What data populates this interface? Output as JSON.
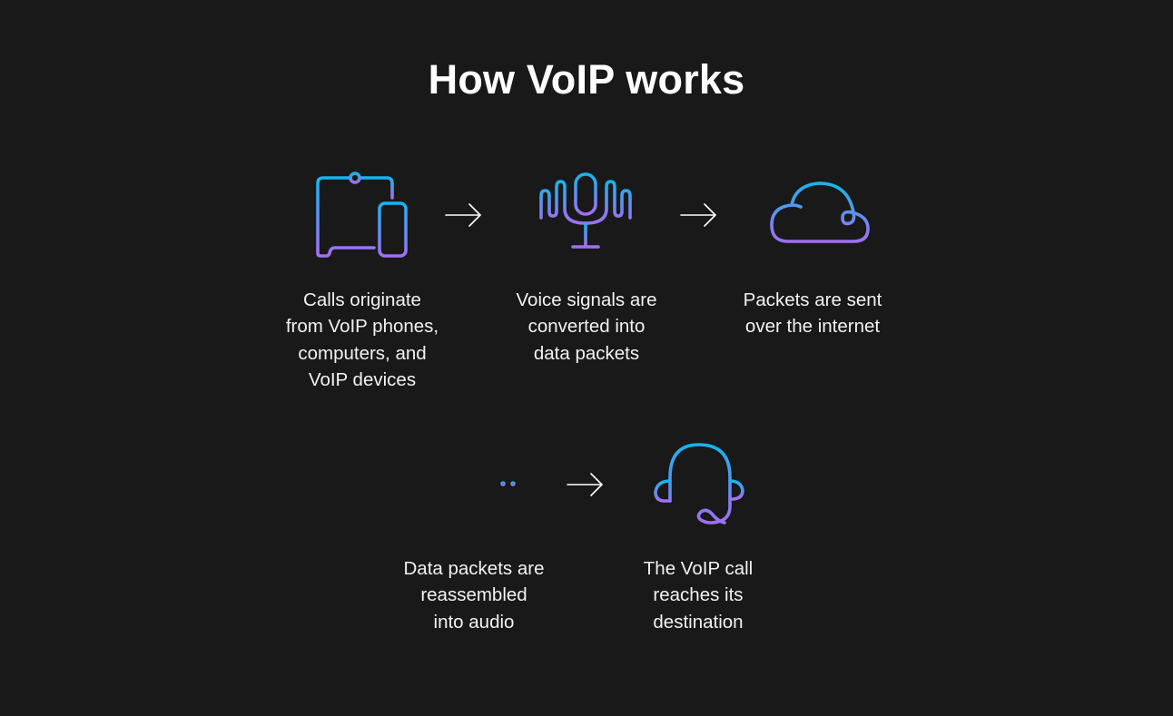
{
  "title": "How VoIP works",
  "colors": {
    "background": "#191919",
    "gradient_top": "#1ab4ec",
    "gradient_bottom": "#a070f2",
    "text": "#ffffff",
    "arrow": "#ffffff"
  },
  "steps": [
    {
      "icon": "devices-icon",
      "caption": "Calls originate\nfrom VoIP phones,\ncomputers, and\nVoIP devices"
    },
    {
      "icon": "microphone-waves-icon",
      "caption": "Voice signals are\nconverted into\ndata packets"
    },
    {
      "icon": "cloud-icon",
      "caption": "Packets are sent\nover the internet"
    },
    {
      "icon": "audio-waveform-icon",
      "caption": "Data packets are\nreassembled\ninto audio"
    },
    {
      "icon": "headset-icon",
      "caption": "The VoIP call\nreaches its\ndestination"
    }
  ],
  "connectors": [
    {
      "from": 0,
      "to": 1,
      "icon": "arrow-right-icon"
    },
    {
      "from": 1,
      "to": 2,
      "icon": "arrow-right-icon"
    },
    {
      "from": 3,
      "to": 4,
      "icon": "arrow-right-icon"
    }
  ]
}
